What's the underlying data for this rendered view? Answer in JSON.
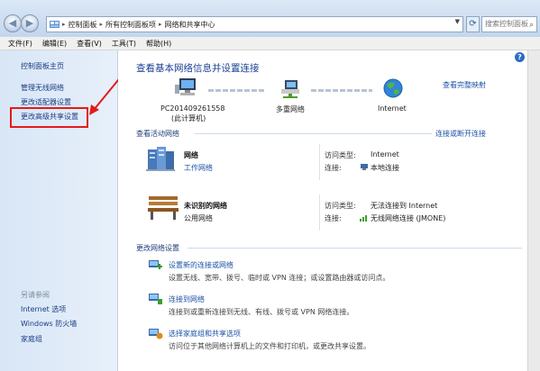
{
  "address": {
    "segments": [
      "控制面板",
      "所有控制面板项",
      "网络和共享中心"
    ],
    "search_placeholder": "搜索控制面板"
  },
  "menu": [
    "文件(F)",
    "编辑(E)",
    "查看(V)",
    "工具(T)",
    "帮助(H)"
  ],
  "left_links": [
    "控制面板主页",
    "管理无线网络",
    "更改适配器设置",
    "更改高级共享设置"
  ],
  "see_also": {
    "heading": "另请参阅",
    "links": [
      "Internet 选项",
      "Windows 防火墙",
      "家庭组"
    ]
  },
  "main": {
    "title": "查看基本网络信息并设置连接",
    "full_map": "查看完整映射",
    "nodes": [
      {
        "label": "PC201409261558",
        "sub": "(此计算机)"
      },
      {
        "label": "多重网络",
        "sub": ""
      },
      {
        "label": "Internet",
        "sub": ""
      }
    ],
    "active_heading": "查看活动网络",
    "connect_link": "连接或断开连接",
    "networks": [
      {
        "name": "网络",
        "type": "工作网络",
        "access_key": "访问类型:",
        "access_val": "Internet",
        "conn_key": "连接:",
        "conn_val": "本地连接"
      },
      {
        "name": "未识别的网络",
        "type": "公用网络",
        "access_key": "访问类型:",
        "access_val": "无法连接到 Internet",
        "conn_key": "连接:",
        "conn_val": "无线网络连接 (JMONE)"
      }
    ],
    "change_heading": "更改网络设置",
    "tasks": [
      {
        "link": "设置新的连接或网络",
        "desc": "设置无线、宽带、拨号、临时或 VPN 连接；或设置路由器或访问点。"
      },
      {
        "link": "连接到网络",
        "desc": "连接到或重新连接到无线、有线、拨号或 VPN 网络连接。"
      },
      {
        "link": "选择家庭组和共享选项",
        "desc": "访问位于其他网络计算机上的文件和打印机，或更改共享设置。"
      }
    ]
  },
  "colors": {
    "link": "#1b52a6",
    "highlight": "#e41a1a",
    "title": "#1c3f94"
  }
}
